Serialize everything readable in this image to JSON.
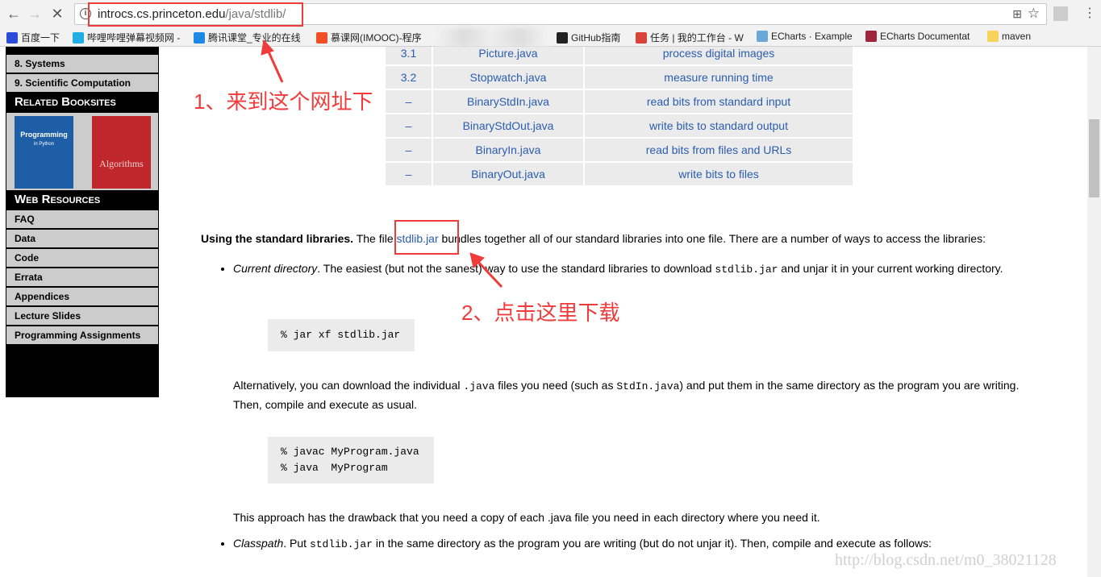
{
  "browser": {
    "url_host": "introcs.cs.princeton.edu",
    "url_path": "/java/stdlib/",
    "bookmarks": [
      {
        "label": "百度一下",
        "color": "#2b4bd8"
      },
      {
        "label": "哔哩哔哩弹幕视频网 -",
        "color": "#23ade5"
      },
      {
        "label": "腾讯课堂_专业的在线",
        "color": "#1e88e5"
      },
      {
        "label": "慕课网(IMOOC)-程序",
        "color": "#f04e23"
      },
      {
        "label": "GitHub指南",
        "color": "#222222"
      },
      {
        "label": "任务 | 我的工作台 - W",
        "color": "#d9443a"
      },
      {
        "label": "ECharts · Example",
        "color": "#6aa8d8"
      },
      {
        "label": "ECharts Documentat",
        "color": "#a0243c"
      },
      {
        "label": "maven",
        "color": "#f7d35c"
      }
    ]
  },
  "sidebar": {
    "items_top": [
      "8.  Systems",
      "9.  Scientific Computation"
    ],
    "related_header": "Related Booksites",
    "books": [
      {
        "title": "Programming",
        "subtitle": "in Python",
        "color": "#1d5ea6"
      },
      {
        "title": "Algorithms",
        "color": "#c0272d"
      }
    ],
    "web_header": "Web Resources",
    "web_items": [
      "FAQ",
      "Data",
      "Code",
      "Errata",
      "Appendices",
      "Lecture Slides",
      "Programming Assignments"
    ]
  },
  "table": {
    "rows": [
      [
        "3.1",
        "Picture.java",
        "process digital images"
      ],
      [
        "3.2",
        "Stopwatch.java",
        "measure running time"
      ],
      [
        "–",
        "BinaryStdIn.java",
        "read bits from standard input"
      ],
      [
        "–",
        "BinaryStdOut.java",
        "write bits to standard output"
      ],
      [
        "–",
        "BinaryIn.java",
        "read bits from files and URLs"
      ],
      [
        "–",
        "BinaryOut.java",
        "write bits to files"
      ]
    ]
  },
  "main": {
    "intro_bold": "Using the standard libraries.",
    "intro_pre": " The file ",
    "intro_link": "stdlib.jar",
    "intro_post": " bundles together all of our standard libraries into one file. There are a number of ways to access the libraries:",
    "b1_em": "Current directory",
    "b1_text": ". The easiest (but not the sanest) way to use the standard libraries to download ",
    "b1_code": "stdlib.jar",
    "b1_text2": " and unjar it in your current working directory.",
    "code1": "% jar xf stdlib.jar",
    "alt_text1": "Alternatively, you can download the individual ",
    "alt_code1": ".java",
    "alt_text2": " files you need (such as ",
    "alt_code2": "StdIn.java",
    "alt_text3": ") and put them in the same directory as the program you are writing. Then, compile and execute as usual.",
    "code2": "% javac MyProgram.java\n% java  MyProgram",
    "drawback": "This approach has the drawback that you need a copy of each .java file you need in each directory where you need it.",
    "b2_em": "Classpath",
    "b2_text": ". Put ",
    "b2_code": "stdlib.jar",
    "b2_text2": " in the same directory as the program you are writing (but do not unjar it). Then, compile and execute as follows:"
  },
  "annotations": {
    "step1": "1、来到这个网址下",
    "step2": "2、点击这里下载",
    "color": "#f03b3b"
  },
  "watermark": "http://blog.csdn.net/m0_38021128"
}
